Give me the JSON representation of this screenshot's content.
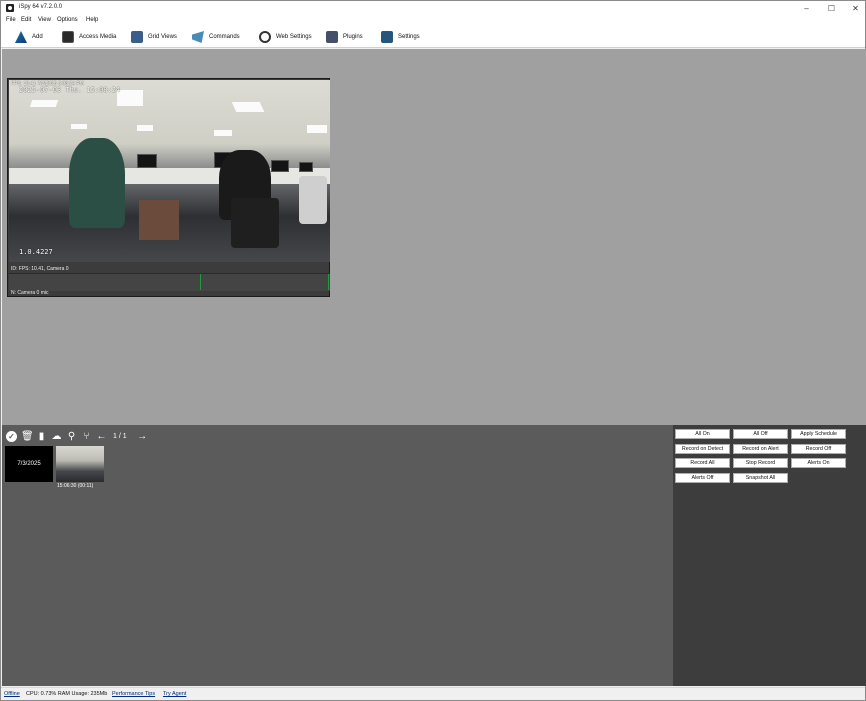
{
  "window": {
    "title": "iSpy 64 v7.2.0.0"
  },
  "menu": [
    "File",
    "Edit",
    "View",
    "Options",
    "Help"
  ],
  "toolbar": [
    {
      "label": "Add",
      "icon": "add-camera-icon"
    },
    {
      "label": "Access Media",
      "icon": "media-icon"
    },
    {
      "label": "Grid Views",
      "icon": "grid-views-icon"
    },
    {
      "label": "Commands",
      "icon": "commands-icon"
    },
    {
      "label": "Web Settings",
      "icon": "web-settings-icon"
    },
    {
      "label": "Plugins",
      "icon": "plugins-icon"
    },
    {
      "label": "Settings",
      "icon": "settings-icon"
    }
  ],
  "camera": {
    "osd_top": "FPS: 10.41 7/3/2025 3:08:24 PM",
    "osd_date": "2025-07-03 Thu. 15:08:24",
    "osd_bottom": "1.0.4227",
    "status": "ID: FPS: 10.41, Camera 0",
    "mic": "N: Camera 0 mic"
  },
  "timeline": {
    "page": "1 / 1",
    "date_tile": "7/3/2025",
    "thumb_caption": "15:06:30 (00:11)"
  },
  "actions": [
    "All On",
    "All Off",
    "Apply Schedule",
    "Record on Detect",
    "Record on Alert",
    "Record Off",
    "Record All",
    "Stop Record",
    "Alerts On",
    "Alerts Off",
    "Snapshot All"
  ],
  "status": {
    "offline": "Offline",
    "cpu": "CPU: 0.73% RAM Usage: 235Mb",
    "perf": "Performance Tips",
    "agent": "Try Agent"
  },
  "colors": {
    "main_bg": "#a0a0a0",
    "bottom_bg": "#5b5b5b",
    "panel_bg": "#3d3d3d",
    "audio_level": "#1e9e3a"
  }
}
